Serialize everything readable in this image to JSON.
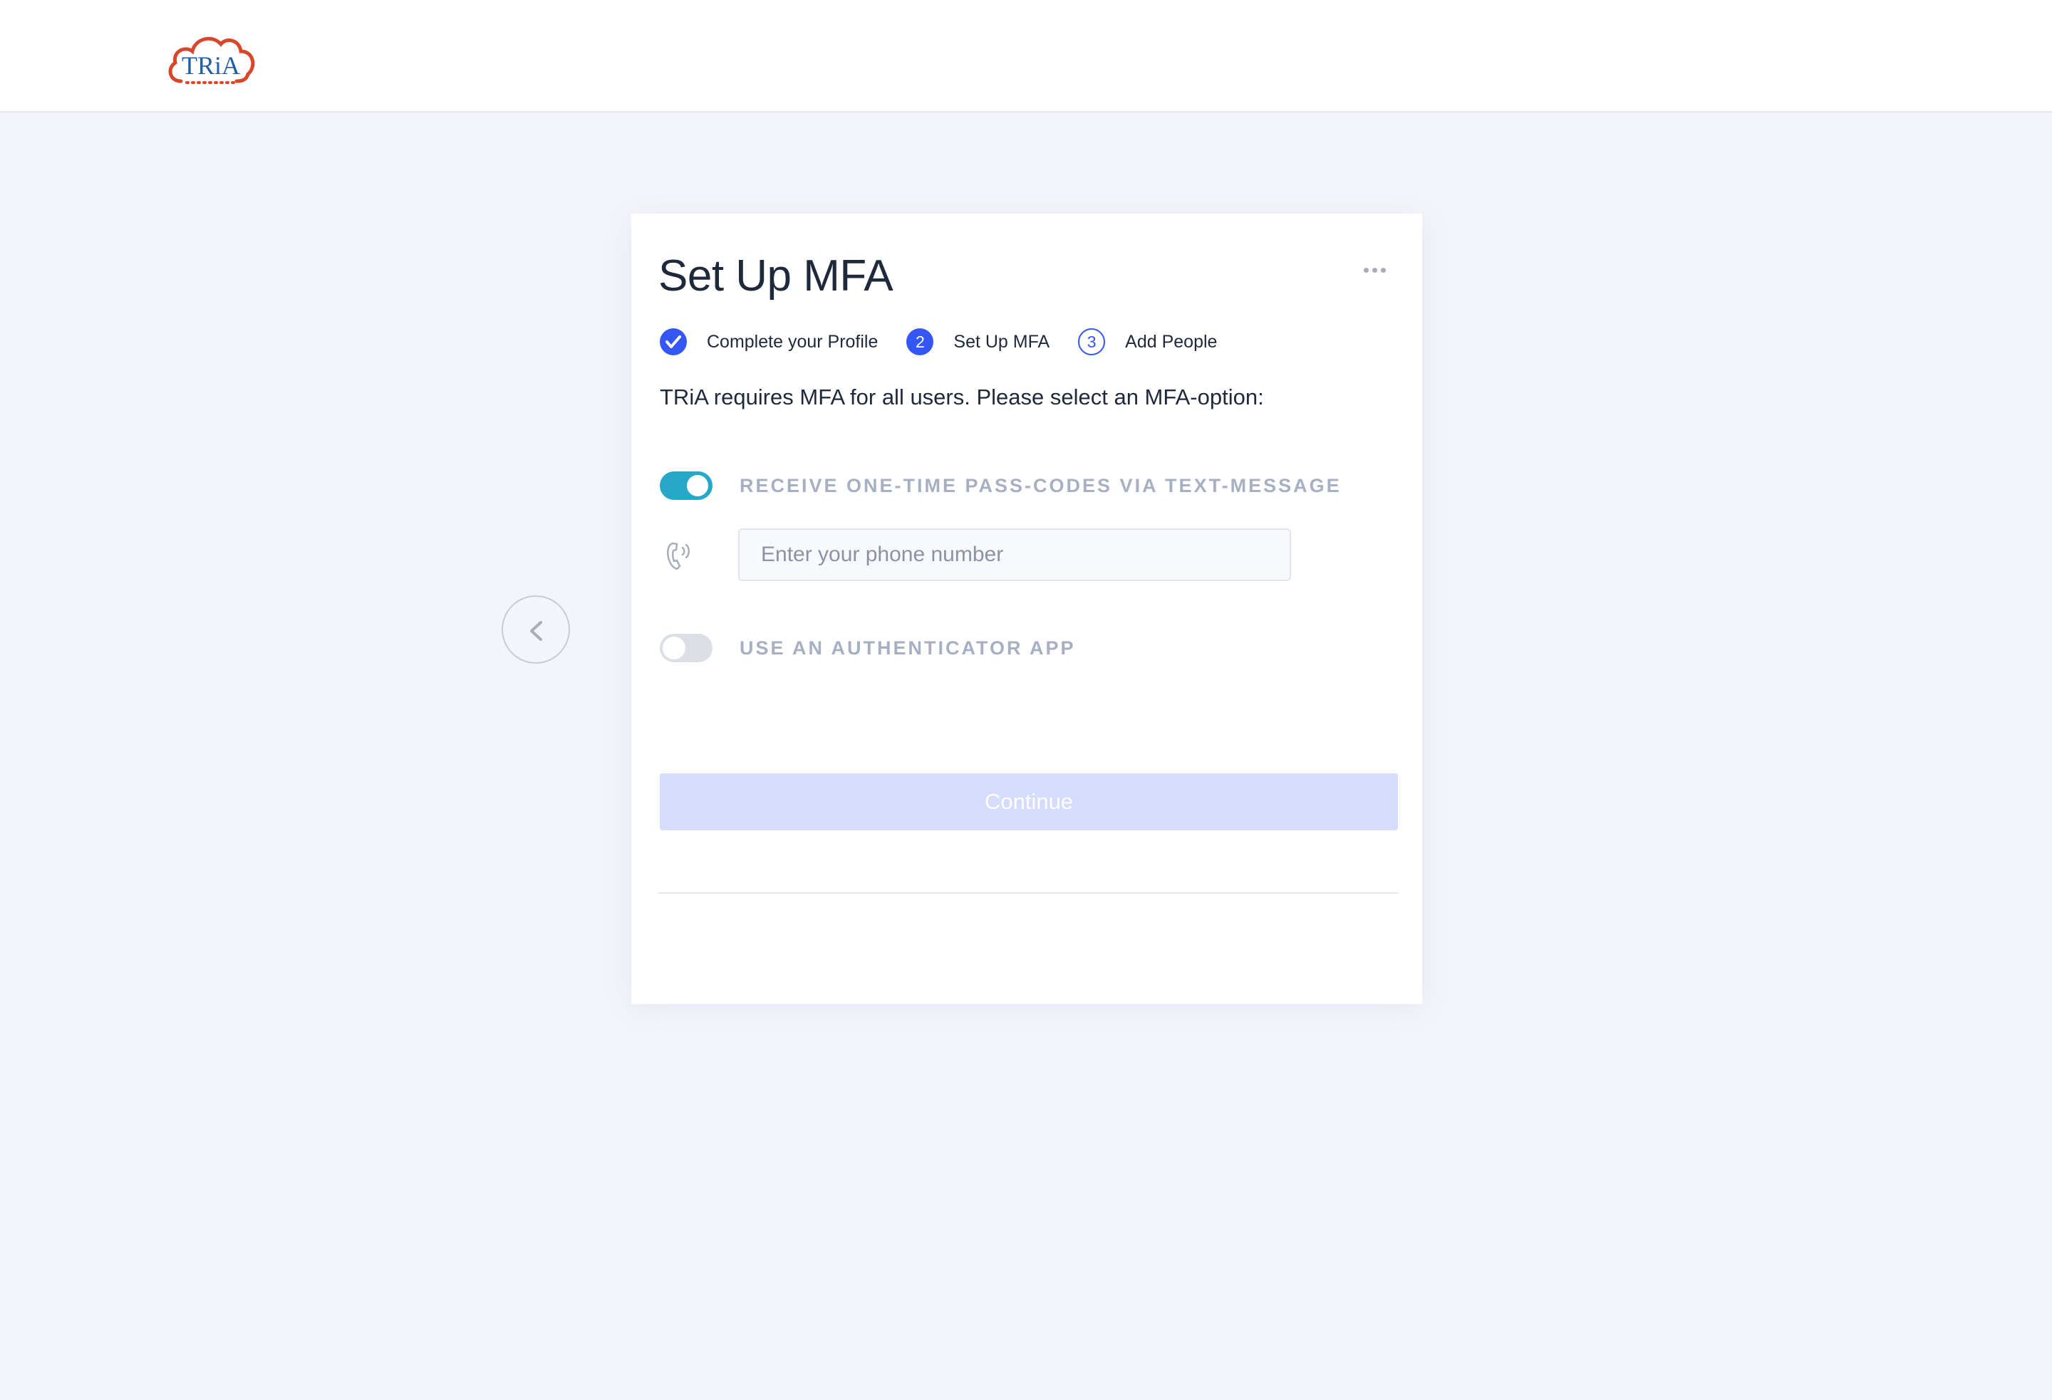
{
  "header": {
    "logo_text": "TRiA"
  },
  "nav": {
    "back_icon": "chevron-left-icon"
  },
  "card": {
    "title": "Set Up MFA",
    "more_icon": "more-horizontal-icon",
    "steps": [
      {
        "label": "Complete your Profile",
        "state": "complete",
        "marker": ""
      },
      {
        "label": "Set Up MFA",
        "state": "active",
        "marker": "2"
      },
      {
        "label": "Add People",
        "state": "pending",
        "marker": "3"
      }
    ],
    "intro": "TRiA requires MFA for all users. Please select an MFA-option:",
    "options": {
      "sms": {
        "label": "RECEIVE ONE-TIME PASS-CODES VIA TEXT-MESSAGE",
        "enabled": true
      },
      "authenticator": {
        "label": "USE AN AUTHENTICATOR APP",
        "enabled": false
      }
    },
    "phone": {
      "placeholder": "Enter your phone number",
      "value": "",
      "icon": "phone-icon"
    },
    "continue_label": "Continue"
  },
  "colors": {
    "accent": "#3456f3",
    "toggle_on": "#27a8c9",
    "continue_disabled": "#d5dcfc",
    "logo_red": "#d9472b",
    "logo_blue": "#1f5ea8"
  }
}
